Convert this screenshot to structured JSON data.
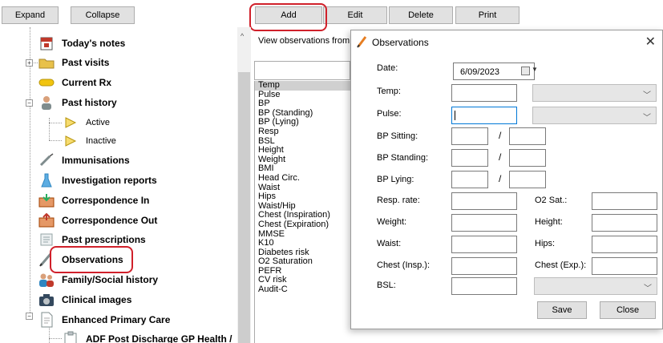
{
  "toolbar": {
    "expand": "Expand",
    "collapse": "Collapse",
    "add": "Add",
    "edit": "Edit",
    "delete": "Delete",
    "print": "Print"
  },
  "tree": {
    "items": [
      {
        "label": "Today's notes",
        "icon": "notes-calendar-icon"
      },
      {
        "label": "Past visits",
        "icon": "folder-icon"
      },
      {
        "label": "Current Rx",
        "icon": "pill-icon"
      },
      {
        "label": "Past history",
        "icon": "person-icon"
      },
      {
        "label": "Active",
        "icon": "triangle-icon"
      },
      {
        "label": "Inactive",
        "icon": "triangle-icon"
      },
      {
        "label": "Immunisations",
        "icon": "syringe-icon"
      },
      {
        "label": "Investigation reports",
        "icon": "flask-icon"
      },
      {
        "label": "Correspondence In",
        "icon": "letter-in-icon"
      },
      {
        "label": "Correspondence Out",
        "icon": "letter-out-icon"
      },
      {
        "label": "Past prescriptions",
        "icon": "prescription-icon"
      },
      {
        "label": "Observations",
        "icon": "pencil-icon"
      },
      {
        "label": "Family/Social history",
        "icon": "family-icon"
      },
      {
        "label": "Clinical images",
        "icon": "camera-icon"
      },
      {
        "label": "Enhanced Primary Care",
        "icon": "document-icon"
      },
      {
        "label": "ADF Post Discharge GP Health /",
        "icon": "clipboard-icon"
      }
    ]
  },
  "middle": {
    "header": "View observations from",
    "observations": [
      "Temp",
      "Pulse",
      "BP",
      "BP (Standing)",
      "BP (Lying)",
      "Resp",
      "BSL",
      "Height",
      "Weight",
      "BMI",
      "Head Circ.",
      "Waist",
      "Hips",
      "Waist/Hip",
      "Chest (Inspiration)",
      "Chest (Expiration)",
      "MMSE",
      "K10",
      "Diabetes risk",
      "O2 Saturation",
      "PEFR",
      "CV risk",
      "Audit-C"
    ]
  },
  "dialog": {
    "title": "Observations",
    "labels": {
      "date": "Date:",
      "temp": "Temp:",
      "pulse": "Pulse:",
      "bp_sitting": "BP Sitting:",
      "bp_standing": "BP Standing:",
      "bp_lying": "BP Lying:",
      "resp_rate": "Resp. rate:",
      "o2_sat": "O2 Sat.:",
      "weight": "Weight:",
      "height": "Height:",
      "waist": "Waist:",
      "hips": "Hips:",
      "chest_insp": "Chest (Insp.):",
      "chest_exp": "Chest (Exp.):",
      "bsl": "BSL:"
    },
    "date_value": "6/09/2023",
    "slash": "/",
    "save": "Save",
    "close": "Close"
  },
  "colors": {
    "highlight": "#d0202a",
    "focus": "#0078d7",
    "selected_row": "#d0d0d0"
  }
}
